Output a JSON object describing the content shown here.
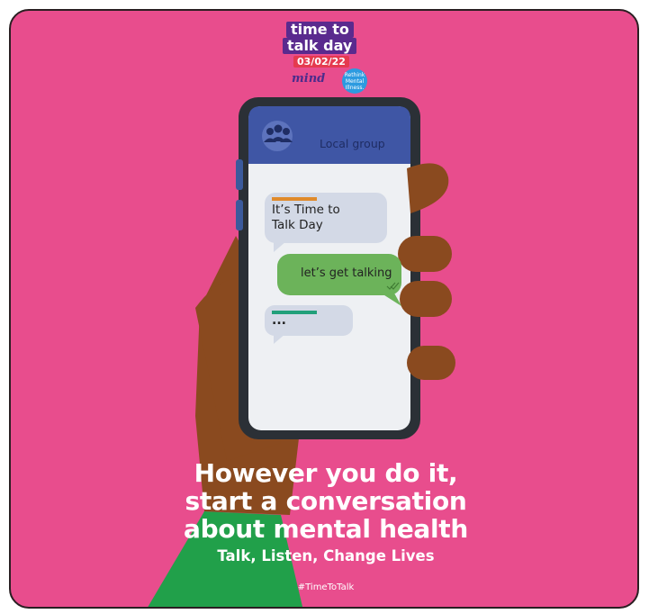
{
  "logo": {
    "line1": "time to",
    "line2": "talk day",
    "date": "03/02/22",
    "partner1": "mind",
    "partner2": "Rethink Mental Illness."
  },
  "chat": {
    "group_name": "Local group",
    "messages": [
      {
        "text_line1": "It’s Time to",
        "text_line2": "Talk Day",
        "side": "left"
      },
      {
        "text_line1": "let’s get talking",
        "side": "right"
      },
      {
        "text_line1": "...",
        "side": "left"
      }
    ]
  },
  "headline": {
    "line1": "However you do it,",
    "line2": "start a conversation",
    "line3": "about mental health"
  },
  "tagline": "Talk, Listen, Change Lives",
  "hashtag": "#TimeToTalk",
  "colors": {
    "background": "#e84d8d",
    "phone_body": "#2b3036",
    "chat_header": "#3f56a5",
    "incoming_bubble": "#d3d9e6",
    "outgoing_bubble": "#6cb35a",
    "skin": "#8a4a1f",
    "sleeve": "#21a04a"
  }
}
